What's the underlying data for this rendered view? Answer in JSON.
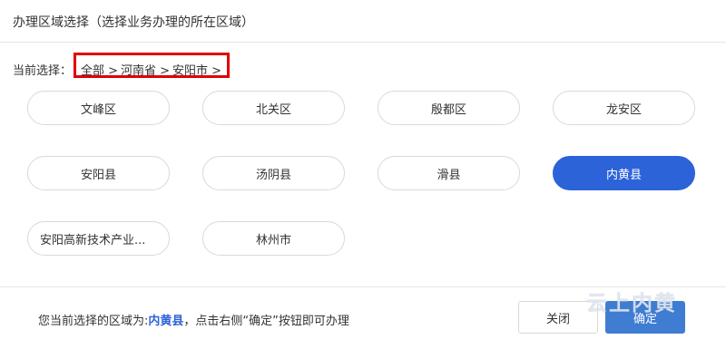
{
  "header": {
    "title": "办理区域选择（选择业务办理的所在区域）"
  },
  "breadcrumb": {
    "label": "当前选择：",
    "items": [
      "全部 >",
      "河南省 >",
      "安阳市 >"
    ]
  },
  "regions": [
    {
      "label": "文峰区"
    },
    {
      "label": "北关区"
    },
    {
      "label": "殷都区"
    },
    {
      "label": "龙安区"
    },
    {
      "label": "安阳县"
    },
    {
      "label": "汤阴县"
    },
    {
      "label": "滑县"
    },
    {
      "label": "内黄县",
      "selected": true
    },
    {
      "label": "安阳高新技术产业..."
    },
    {
      "label": "林州市"
    }
  ],
  "footer": {
    "prefix": "您当前选择的区域为:",
    "selected_region": "内黄县",
    "suffix": "，点击右侧“确定”按钮即可办理",
    "close_label": "关闭",
    "ok_label": "确定"
  },
  "watermark": {
    "text": "云上内黄"
  },
  "colors": {
    "accent": "#2c63d9",
    "highlight_box": "#e00000"
  }
}
